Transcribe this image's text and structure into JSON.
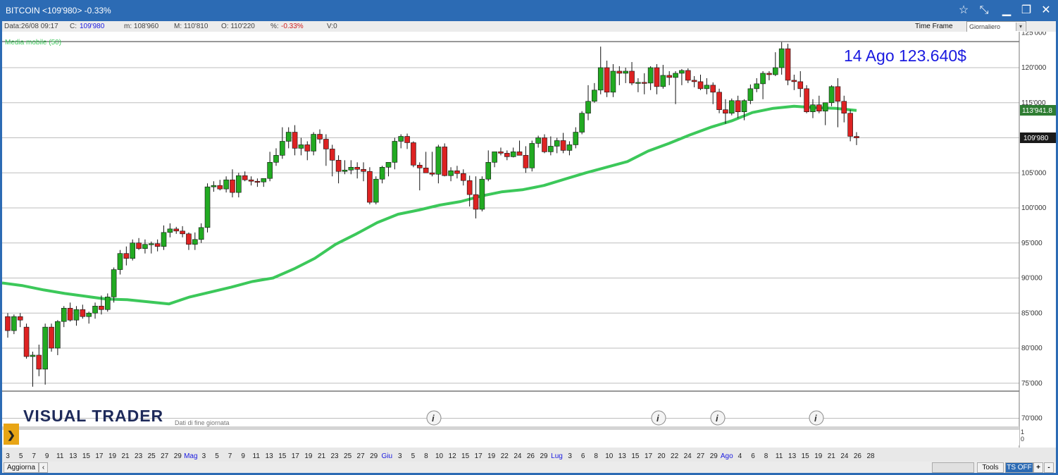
{
  "window": {
    "title": "BITCOIN <109'980> -0.33%",
    "controls": [
      "star-icon",
      "pin-icon",
      "minimize-icon",
      "restore-icon",
      "close-icon"
    ]
  },
  "infobar": {
    "data": "Data:26/08 09:17",
    "close_label": "C:",
    "close_value": "109'980",
    "min": "m: 108'960",
    "max": "M: 110'810",
    "open": "O: 110'220",
    "pct_label": "%:",
    "pct_value": "-0.33%",
    "volume": "V:0",
    "timeframe_label": "Time Frame",
    "timeframe_value": "Giornaliero"
  },
  "chart": {
    "indicator_label": "Media mobile (50)",
    "annotation": "14 Ago 123.640$",
    "brand": "VISUAL TRADER",
    "subtitle": "Dati di fine giornata",
    "last_price_label": "109'980",
    "ma_value_label": "113'941.8",
    "y_ticks": [
      "125'000",
      "120'000",
      "115'000",
      "110'000",
      "105'000",
      "100'000",
      "95'000",
      "90'000",
      "85'000",
      "80'000",
      "75'000",
      "70'000"
    ],
    "sub_ticks": [
      "1",
      "0"
    ],
    "x_labels": [
      "3",
      "5",
      "7",
      "9",
      "11",
      "13",
      "15",
      "17",
      "19",
      "21",
      "23",
      "25",
      "27",
      "29",
      "Mag",
      "3",
      "5",
      "7",
      "9",
      "11",
      "13",
      "15",
      "17",
      "19",
      "21",
      "23",
      "25",
      "27",
      "29",
      "Giu",
      "3",
      "5",
      "8",
      "10",
      "12",
      "15",
      "17",
      "19",
      "22",
      "24",
      "26",
      "29",
      "Lug",
      "3",
      "6",
      "8",
      "10",
      "13",
      "15",
      "17",
      "20",
      "22",
      "24",
      "27",
      "29",
      "Ago",
      "4",
      "6",
      "8",
      "11",
      "13",
      "15",
      "19",
      "21",
      "24",
      "26",
      "28"
    ],
    "month_labels": [
      "Mag",
      "Giu",
      "Lug",
      "Ago"
    ],
    "colors": {
      "up": "#22aa22",
      "down": "#dd2222",
      "ma": "#3cc85a",
      "annotation": "#1a1ae0"
    }
  },
  "bottombar": {
    "refresh": "Aggiorna",
    "tools": "Tools",
    "ts": "TS OFF",
    "plus": "+",
    "minus": "-"
  },
  "chart_data": {
    "type": "candlestick",
    "unit": "USD",
    "ylim": [
      70000,
      125000
    ],
    "indicator": "Media mobile (50)",
    "candles": [
      [
        84500,
        85000,
        81500,
        82500
      ],
      [
        82500,
        84800,
        82000,
        84500
      ],
      [
        84500,
        85000,
        83000,
        84000
      ],
      [
        83000,
        83500,
        78500,
        78800
      ],
      [
        78800,
        79500,
        74500,
        79000
      ],
      [
        79000,
        80500,
        76000,
        77000
      ],
      [
        77000,
        83500,
        74800,
        83000
      ],
      [
        83000,
        83500,
        79500,
        80000
      ],
      [
        80000,
        84000,
        79000,
        83800
      ],
      [
        83800,
        86000,
        83000,
        85700
      ],
      [
        85700,
        86500,
        83800,
        84000
      ],
      [
        84000,
        86000,
        83200,
        85500
      ],
      [
        85500,
        86200,
        84200,
        84500
      ],
      [
        84500,
        85200,
        83500,
        85000
      ],
      [
        85000,
        86500,
        84200,
        86000
      ],
      [
        86000,
        87500,
        84800,
        85500
      ],
      [
        85500,
        87800,
        85200,
        87300
      ],
      [
        87300,
        91500,
        86500,
        91200
      ],
      [
        91200,
        94000,
        90500,
        93500
      ],
      [
        93500,
        94500,
        91800,
        92800
      ],
      [
        92800,
        95500,
        92500,
        95000
      ],
      [
        95000,
        95700,
        94000,
        94200
      ],
      [
        94200,
        95500,
        93500,
        94800
      ],
      [
        94800,
        95200,
        93500,
        94900
      ],
      [
        94900,
        95500,
        93800,
        94500
      ],
      [
        94500,
        97500,
        94000,
        96500
      ],
      [
        96500,
        97800,
        95800,
        97000
      ],
      [
        97000,
        97300,
        96300,
        96700
      ],
      [
        96700,
        97400,
        95800,
        96300
      ],
      [
        96300,
        96500,
        94000,
        94800
      ],
      [
        94800,
        96500,
        94000,
        95500
      ],
      [
        95500,
        97800,
        95000,
        97200
      ],
      [
        97200,
        103500,
        96500,
        103000
      ],
      [
        103000,
        103800,
        102300,
        103200
      ],
      [
        103200,
        104000,
        102500,
        102700
      ],
      [
        102700,
        104500,
        102200,
        104000
      ],
      [
        104000,
        105500,
        101500,
        102200
      ],
      [
        102200,
        105000,
        101500,
        104600
      ],
      [
        104600,
        105200,
        103800,
        104000
      ],
      [
        104000,
        104500,
        103200,
        103800
      ],
      [
        103800,
        104200,
        103000,
        103700
      ],
      [
        103700,
        104000,
        103000,
        104200
      ],
      [
        104200,
        108000,
        103800,
        106500
      ],
      [
        106500,
        108500,
        106000,
        107500
      ],
      [
        107500,
        111500,
        107000,
        109500
      ],
      [
        109500,
        111500,
        108500,
        110800
      ],
      [
        110800,
        111800,
        107500,
        108500
      ],
      [
        108500,
        110000,
        107500,
        109000
      ],
      [
        109000,
        109500,
        106800,
        108100
      ],
      [
        108100,
        110800,
        107500,
        110500
      ],
      [
        110500,
        111200,
        109200,
        109800
      ],
      [
        109800,
        110500,
        106000,
        108400
      ],
      [
        108400,
        109000,
        104500,
        106800
      ],
      [
        106800,
        107500,
        103500,
        105200
      ],
      [
        105200,
        106800,
        104800,
        105400
      ],
      [
        105400,
        106800,
        104800,
        105800
      ],
      [
        105800,
        106500,
        104200,
        105500
      ],
      [
        105500,
        106500,
        103800,
        105200
      ],
      [
        105200,
        105800,
        100500,
        100800
      ],
      [
        100800,
        104500,
        100500,
        104100
      ],
      [
        104100,
        106000,
        103500,
        105800
      ],
      [
        105800,
        106200,
        104500,
        106500
      ],
      [
        106500,
        110000,
        105500,
        109500
      ],
      [
        109500,
        110500,
        108500,
        110200
      ],
      [
        110200,
        110600,
        108400,
        109300
      ],
      [
        109300,
        109500,
        105800,
        106100
      ],
      [
        106100,
        106500,
        102500,
        105700
      ],
      [
        105700,
        108000,
        105000,
        105000
      ],
      [
        105000,
        108000,
        104500,
        104800
      ],
      [
        104800,
        109000,
        103500,
        108700
      ],
      [
        108700,
        109200,
        104500,
        104600
      ],
      [
        104600,
        105800,
        103800,
        105300
      ],
      [
        105300,
        106000,
        104200,
        104900
      ],
      [
        104900,
        105500,
        103200,
        103900
      ],
      [
        103900,
        104600,
        100200,
        101900
      ],
      [
        101900,
        104500,
        98500,
        99800
      ],
      [
        99800,
        104500,
        99500,
        104100
      ],
      [
        104100,
        108200,
        103800,
        106500
      ],
      [
        106500,
        108000,
        105800,
        108000
      ],
      [
        108000,
        108600,
        107500,
        107800
      ],
      [
        107800,
        108200,
        106800,
        107300
      ],
      [
        107300,
        108600,
        107200,
        108000
      ],
      [
        108000,
        109600,
        107800,
        107500
      ],
      [
        107500,
        108800,
        105000,
        105700
      ],
      [
        105700,
        109600,
        105200,
        109200
      ],
      [
        109200,
        110300,
        108600,
        110000
      ],
      [
        110000,
        110500,
        107800,
        108000
      ],
      [
        108000,
        110200,
        107500,
        108800
      ],
      [
        108800,
        110000,
        107800,
        109600
      ],
      [
        109600,
        110700,
        107800,
        108200
      ],
      [
        108200,
        109500,
        107500,
        109000
      ],
      [
        109000,
        111500,
        108500,
        110800
      ],
      [
        110800,
        113800,
        110500,
        113500
      ],
      [
        113500,
        117500,
        112500,
        115200
      ],
      [
        115200,
        117800,
        115000,
        116800
      ],
      [
        116800,
        123000,
        116200,
        120000
      ],
      [
        120000,
        121000,
        115800,
        116500
      ],
      [
        116500,
        120500,
        115800,
        119500
      ],
      [
        119500,
        120200,
        117500,
        119200
      ],
      [
        119200,
        120000,
        117800,
        119500
      ],
      [
        119500,
        120800,
        117500,
        117800
      ],
      [
        117800,
        118500,
        116500,
        117900
      ],
      [
        117900,
        119200,
        116200,
        117800
      ],
      [
        117800,
        120200,
        116800,
        120000
      ],
      [
        120000,
        120500,
        116200,
        117300
      ],
      [
        117300,
        120400,
        117000,
        118900
      ],
      [
        118900,
        119500,
        117500,
        118600
      ],
      [
        118600,
        119500,
        114800,
        119200
      ],
      [
        119200,
        119800,
        117500,
        119600
      ],
      [
        119600,
        119900,
        117800,
        118200
      ],
      [
        118200,
        118800,
        117200,
        118000
      ],
      [
        118000,
        119000,
        116800,
        117000
      ],
      [
        117000,
        118500,
        116200,
        117500
      ],
      [
        117500,
        117900,
        114800,
        116500
      ],
      [
        116500,
        117000,
        113500,
        114000
      ],
      [
        114000,
        115500,
        112000,
        113500
      ],
      [
        113500,
        115600,
        113200,
        115300
      ],
      [
        115300,
        116000,
        112800,
        113700
      ],
      [
        113700,
        115500,
        112500,
        115300
      ],
      [
        115300,
        117600,
        114800,
        117000
      ],
      [
        117000,
        118500,
        116500,
        117700
      ],
      [
        117700,
        119500,
        115500,
        119200
      ],
      [
        119200,
        119500,
        118200,
        119000
      ],
      [
        119000,
        122200,
        118800,
        120000
      ],
      [
        120000,
        123640,
        119000,
        122700
      ],
      [
        122700,
        123400,
        117500,
        118200
      ],
      [
        118200,
        119000,
        116800,
        118000
      ],
      [
        118000,
        119500,
        115800,
        117000
      ],
      [
        117000,
        117500,
        113500,
        113700
      ],
      [
        113700,
        115500,
        112800,
        114700
      ],
      [
        114700,
        116000,
        113500,
        113800
      ],
      [
        113800,
        114500,
        111800,
        115000
      ],
      [
        115000,
        117500,
        114500,
        117300
      ],
      [
        117300,
        118500,
        111500,
        115200
      ],
      [
        115200,
        116000,
        112200,
        113500
      ],
      [
        113500,
        114000,
        109500,
        110200
      ],
      [
        110200,
        110810,
        108960,
        109980
      ]
    ],
    "ma50_approx": [
      89300,
      88900,
      88300,
      87800,
      87400,
      87000,
      86900,
      86600,
      86300,
      87300,
      88000,
      88700,
      89500,
      90000,
      91300,
      92800,
      94800,
      96300,
      97900,
      99100,
      99700,
      100400,
      100900,
      101700,
      102300,
      102600,
      103200,
      104100,
      105000,
      105800,
      106600,
      108100,
      109200,
      110400,
      111500,
      112400,
      113600,
      114200,
      114500,
      114300,
      114200,
      113900
    ],
    "ma50_last": 113941.8
  }
}
